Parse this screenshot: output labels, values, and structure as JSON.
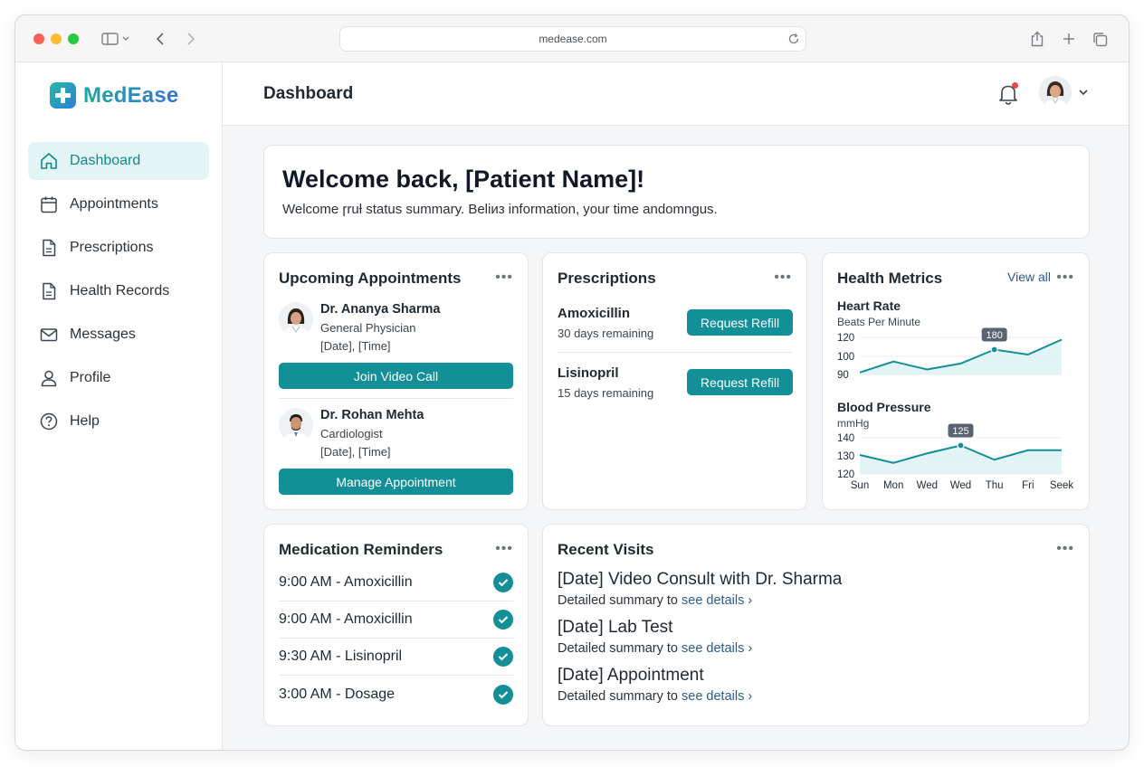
{
  "browser": {
    "url": "medease.com"
  },
  "brand": {
    "name": "MedEase"
  },
  "sidebar": {
    "items": [
      {
        "label": "Dashboard",
        "icon": "home-icon",
        "active": true
      },
      {
        "label": "Appointments",
        "icon": "calendar-icon"
      },
      {
        "label": "Prescriptions",
        "icon": "document-icon"
      },
      {
        "label": "Health Records",
        "icon": "document-icon"
      },
      {
        "label": "Messages",
        "icon": "mail-icon"
      },
      {
        "label": "Profile",
        "icon": "user-icon"
      },
      {
        "label": "Help",
        "icon": "help-icon"
      }
    ]
  },
  "header": {
    "title": "Dashboard",
    "notification_dot": true
  },
  "welcome": {
    "title": "Welcome back, [Patient Name]!",
    "subtitle": "Welcome ɼruƚ status summary. Beliиз information, your time andomngus."
  },
  "appointments": {
    "title": "Upcoming Appointments",
    "items": [
      {
        "doctor": "Dr. Ananya Sharma",
        "specialty": "General Physician",
        "when": "[Date], [Time]",
        "action": "Join Video Call"
      },
      {
        "doctor": "Dr. Rohan Mehta",
        "specialty": "Cardiologist",
        "when": "[Date], [Time]",
        "action": "Manage Appointment"
      }
    ]
  },
  "prescriptions": {
    "title": "Prescriptions",
    "items": [
      {
        "name": "Amoxicillin",
        "remaining": "30 days remaining",
        "action": "Request Refill"
      },
      {
        "name": "Lisinopril",
        "remaining": "15 days remaining",
        "action": "Request Refill"
      }
    ]
  },
  "health_metrics": {
    "title": "Health Metrics",
    "view_all": "View all",
    "heart_rate": {
      "label": "Heart Rate",
      "unit": "Beats Per Minute"
    },
    "blood_pressure": {
      "label": "Blood Pressure",
      "unit": "mmHg"
    }
  },
  "reminders": {
    "title": "Medication Reminders",
    "items": [
      {
        "text": "9:00 AM - Amoxicillin",
        "done": true
      },
      {
        "text": "9:00 AM - Amoxicillin",
        "done": true
      },
      {
        "text": "9:30 AM - Lisinopril",
        "done": true
      },
      {
        "text": "3:00 AM - Dosage",
        "done": true
      }
    ]
  },
  "visits": {
    "title": "Recent Visits",
    "items": [
      {
        "title": "[Date] Video Consult with Dr. Sharma",
        "summary": "Detailed summary to",
        "link": "see details"
      },
      {
        "title": "[Date] Lab Test",
        "summary": "Detailed summary to",
        "link": "see details"
      },
      {
        "title": "[Date] Appointment",
        "summary": "Detailed summary to",
        "link": "see details"
      }
    ]
  },
  "colors": {
    "accent": "#139097",
    "active_bg": "#e3f4f4",
    "link": "#2d5a8c",
    "notification": "#e5484d"
  },
  "chart_data": [
    {
      "type": "line",
      "title": "Heart Rate",
      "ylabel": "Beats Per Minute",
      "y_ticks": [
        "120",
        "100",
        "90"
      ],
      "series": [
        {
          "values": [
            87,
            98,
            90,
            96,
            110,
            105,
            120
          ]
        }
      ],
      "highlight": {
        "index": 4,
        "label": "180"
      },
      "ylim": [
        85,
        125
      ]
    },
    {
      "type": "line",
      "title": "Blood Pressure",
      "ylabel": "mmHg",
      "categories": [
        "Sun",
        "Mon",
        "Wed",
        "Wed",
        "Thu",
        "Fri",
        "Seek"
      ],
      "y_ticks": [
        "140",
        "130",
        "120"
      ],
      "series": [
        {
          "values": [
            132,
            127,
            133,
            138,
            129,
            135,
            135
          ]
        }
      ],
      "highlight": {
        "index": 3,
        "label": "125"
      },
      "ylim": [
        120,
        144
      ]
    }
  ]
}
